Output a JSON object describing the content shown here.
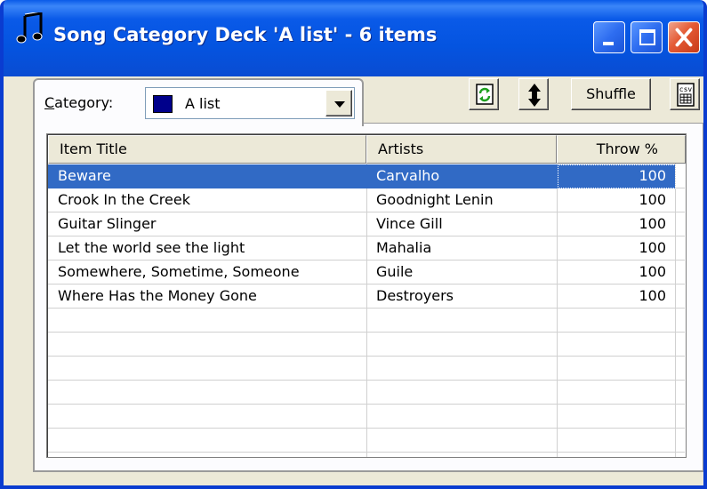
{
  "window": {
    "title": "Song Category Deck 'A list' - 6 items"
  },
  "category": {
    "label_prefix": "",
    "label_underlined": "C",
    "label_rest": "ategory:",
    "selected_value": "A list",
    "swatch_color": "#00008B"
  },
  "toolbar": {
    "shuffle_label": "Shuffle",
    "csv_label": "csv"
  },
  "list": {
    "columns": [
      "Item Title",
      "Artists",
      "Throw %"
    ],
    "rows": [
      {
        "title": "Beware",
        "artist": "Carvalho",
        "throw": "100",
        "selected": true
      },
      {
        "title": "Crook In the Creek",
        "artist": "Goodnight Lenin",
        "throw": "100",
        "selected": false
      },
      {
        "title": "Guitar Slinger",
        "artist": "Vince Gill",
        "throw": "100",
        "selected": false
      },
      {
        "title": "Let the world see the light",
        "artist": "Mahalia",
        "throw": "100",
        "selected": false
      },
      {
        "title": "Somewhere, Sometime, Someone",
        "artist": "Guile",
        "throw": "100",
        "selected": false
      },
      {
        "title": "Where Has the Money Gone",
        "artist": "Destroyers",
        "throw": "100",
        "selected": false
      }
    ]
  },
  "colors": {
    "selection": "#316AC5",
    "titlebar": "#0454E0",
    "close_button": "#E45A34"
  },
  "icons": {
    "title": "music-note-icon",
    "refresh": "refresh-icon",
    "sort": "sort-arrows-icon",
    "csv": "csv-export-icon"
  }
}
